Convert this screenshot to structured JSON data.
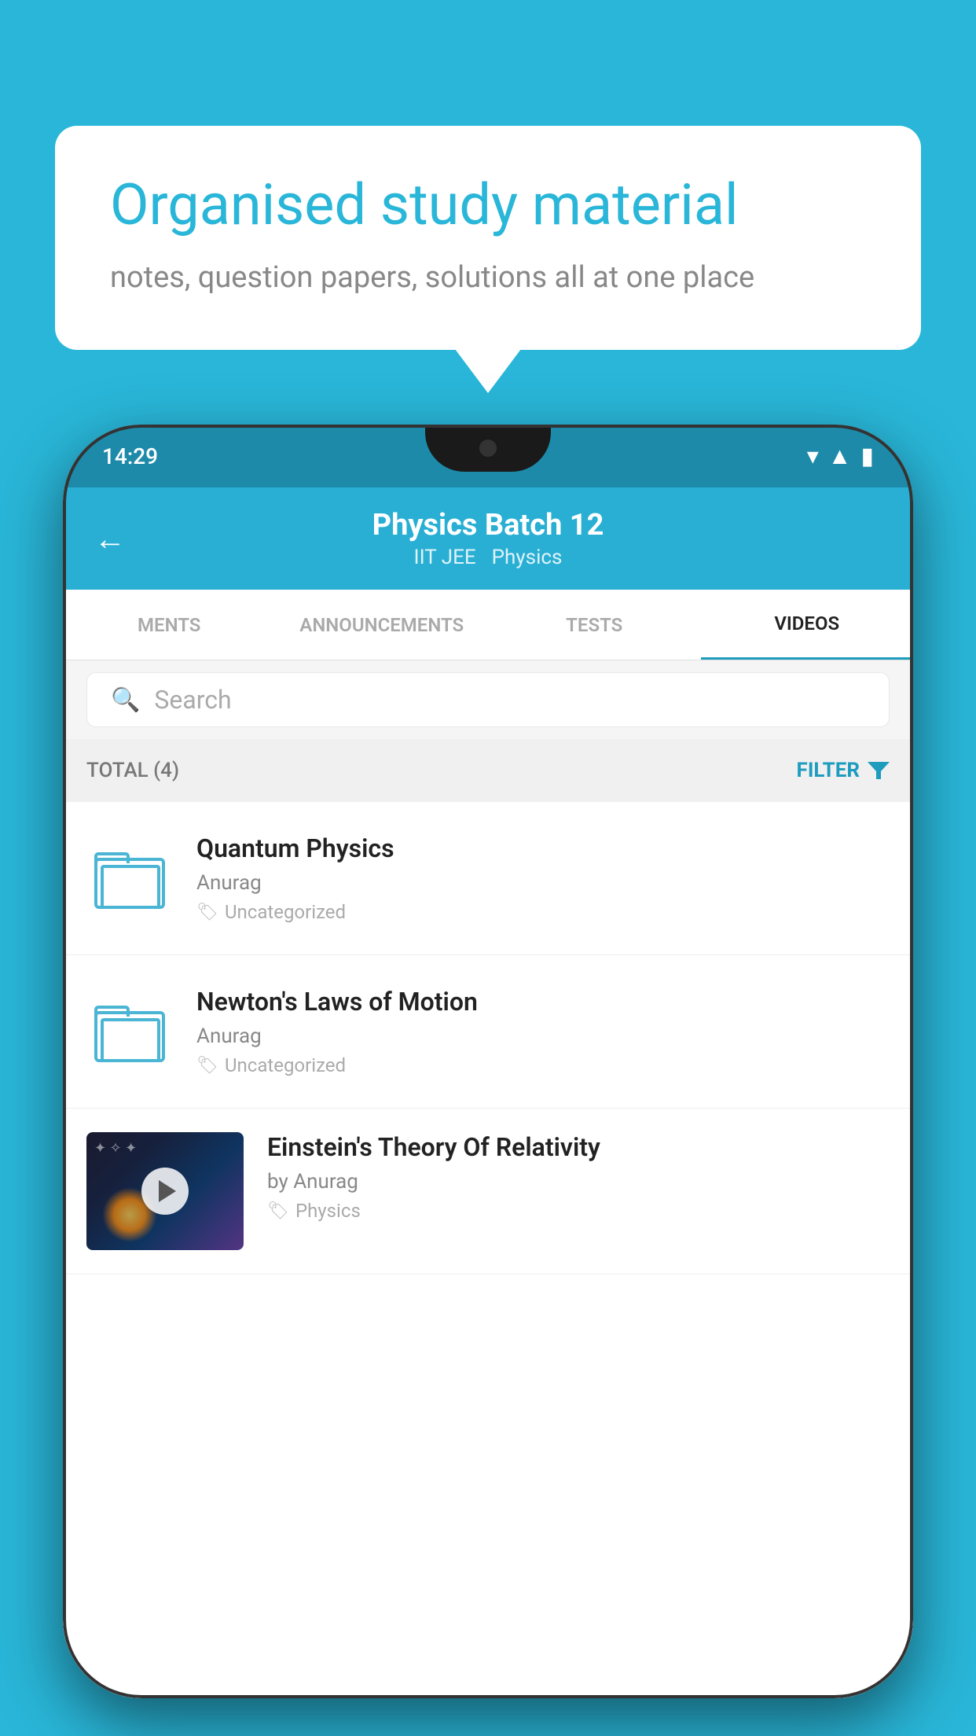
{
  "background_color": "#29b6d8",
  "speech_bubble": {
    "heading": "Organised study material",
    "subtext": "notes, question papers, solutions all at one place"
  },
  "phone": {
    "status_bar": {
      "time": "14:29"
    },
    "header": {
      "title": "Physics Batch 12",
      "subtitle_1": "IIT JEE",
      "subtitle_2": "Physics",
      "back_label": "←"
    },
    "tabs": [
      {
        "label": "MENTS",
        "active": false
      },
      {
        "label": "ANNOUNCEMENTS",
        "active": false
      },
      {
        "label": "TESTS",
        "active": false
      },
      {
        "label": "VIDEOS",
        "active": true
      }
    ],
    "search": {
      "placeholder": "Search"
    },
    "filter_bar": {
      "total_label": "TOTAL (4)",
      "filter_label": "FILTER"
    },
    "videos": [
      {
        "title": "Quantum Physics",
        "author": "Anurag",
        "tag": "Uncategorized",
        "has_thumbnail": false
      },
      {
        "title": "Newton's Laws of Motion",
        "author": "Anurag",
        "tag": "Uncategorized",
        "has_thumbnail": false
      },
      {
        "title": "Einstein's Theory Of Relativity",
        "author": "by Anurag",
        "tag": "Physics",
        "has_thumbnail": true
      }
    ]
  }
}
